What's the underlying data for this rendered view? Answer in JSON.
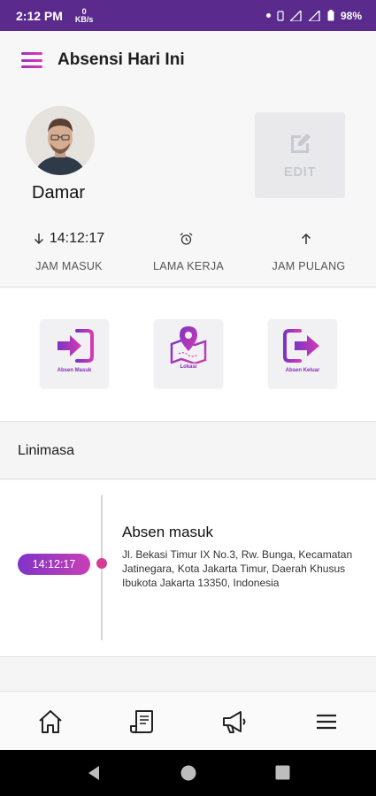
{
  "status_bar": {
    "time": "2:12 PM",
    "speed_value": "0",
    "speed_unit": "KB/s",
    "battery": "98%"
  },
  "app_bar": {
    "title": "Absensi Hari Ini"
  },
  "profile": {
    "name": "Damar",
    "edit_label": "EDIT",
    "stats": [
      {
        "value": "14:12:17",
        "label": "JAM MASUK",
        "icon": "arrow-down-icon"
      },
      {
        "value": "",
        "label": "LAMA KERJA",
        "icon": "alarm-clock-icon"
      },
      {
        "value": "",
        "label": "JAM PULANG",
        "icon": "arrow-up-icon"
      }
    ]
  },
  "actions": [
    {
      "label": "Absen Masuk",
      "icon": "login-icon"
    },
    {
      "label": "Lokasi",
      "icon": "map-pin-icon"
    },
    {
      "label": "Absen Keluar",
      "icon": "logout-icon"
    }
  ],
  "timeline": {
    "header": "Linimasa",
    "entries": [
      {
        "time": "14:12:17",
        "title": "Absen masuk",
        "address": "Jl. Bekasi Timur IX No.3, Rw. Bunga, Kecamatan Jatinegara, Kota Jakarta Timur, Daerah Khusus Ibukota Jakarta 13350, Indonesia"
      }
    ]
  },
  "bottom_nav": [
    "home-icon",
    "receipt-icon",
    "megaphone-icon",
    "menu-icon"
  ],
  "colors": {
    "status_bar": "#5a2a8c",
    "accent_purple": "#8a2ab8",
    "accent_pink": "#d63c93"
  }
}
